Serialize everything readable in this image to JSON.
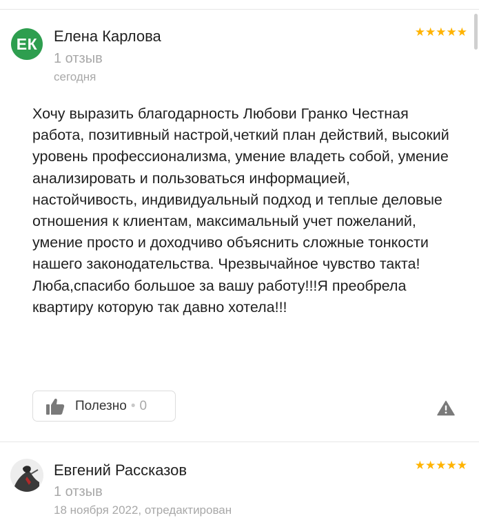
{
  "reviews": [
    {
      "avatar_initials": "ЕК",
      "avatar_color": "#2e9e4f",
      "author": "Елена Карлова",
      "review_count": "1 отзыв",
      "date": "сегодня",
      "rating": 5,
      "stars_text": "★★★★★",
      "text": "Хочу выразить благодарность Любови Гранко Честная работа, позитивный настрой,четкий план действий, высокий уровень профессионализма, умение владеть собой, умение анализировать и пользоваться информацией, настойчивость, индивидуальный подход и теплые деловые отношения к клиентам, максимальный учет пожеланий, умение просто и доходчиво объяснить сложные тонкости нашего законодательства. Чрезвычайное чувство такта! Люба,спасибо большое за вашу работу!!!Я преобрела квартиру которую так давно хотела!!!",
      "helpful_label": "Полезно",
      "helpful_separator": "•",
      "helpful_count": "0",
      "icons": {
        "helpful": "thumbs-up-icon",
        "report": "warning-icon"
      }
    },
    {
      "author": "Евгений Рассказов",
      "review_count": "1 отзыв",
      "date": "18 ноября 2022, отредактирован",
      "rating": 5,
      "stars_text": "★★★★★",
      "icons": {
        "avatar": "photo-avatar"
      }
    }
  ],
  "colors": {
    "star": "#ffb300",
    "muted_text": "#a8a8a8",
    "divider": "#e6e6e6"
  }
}
